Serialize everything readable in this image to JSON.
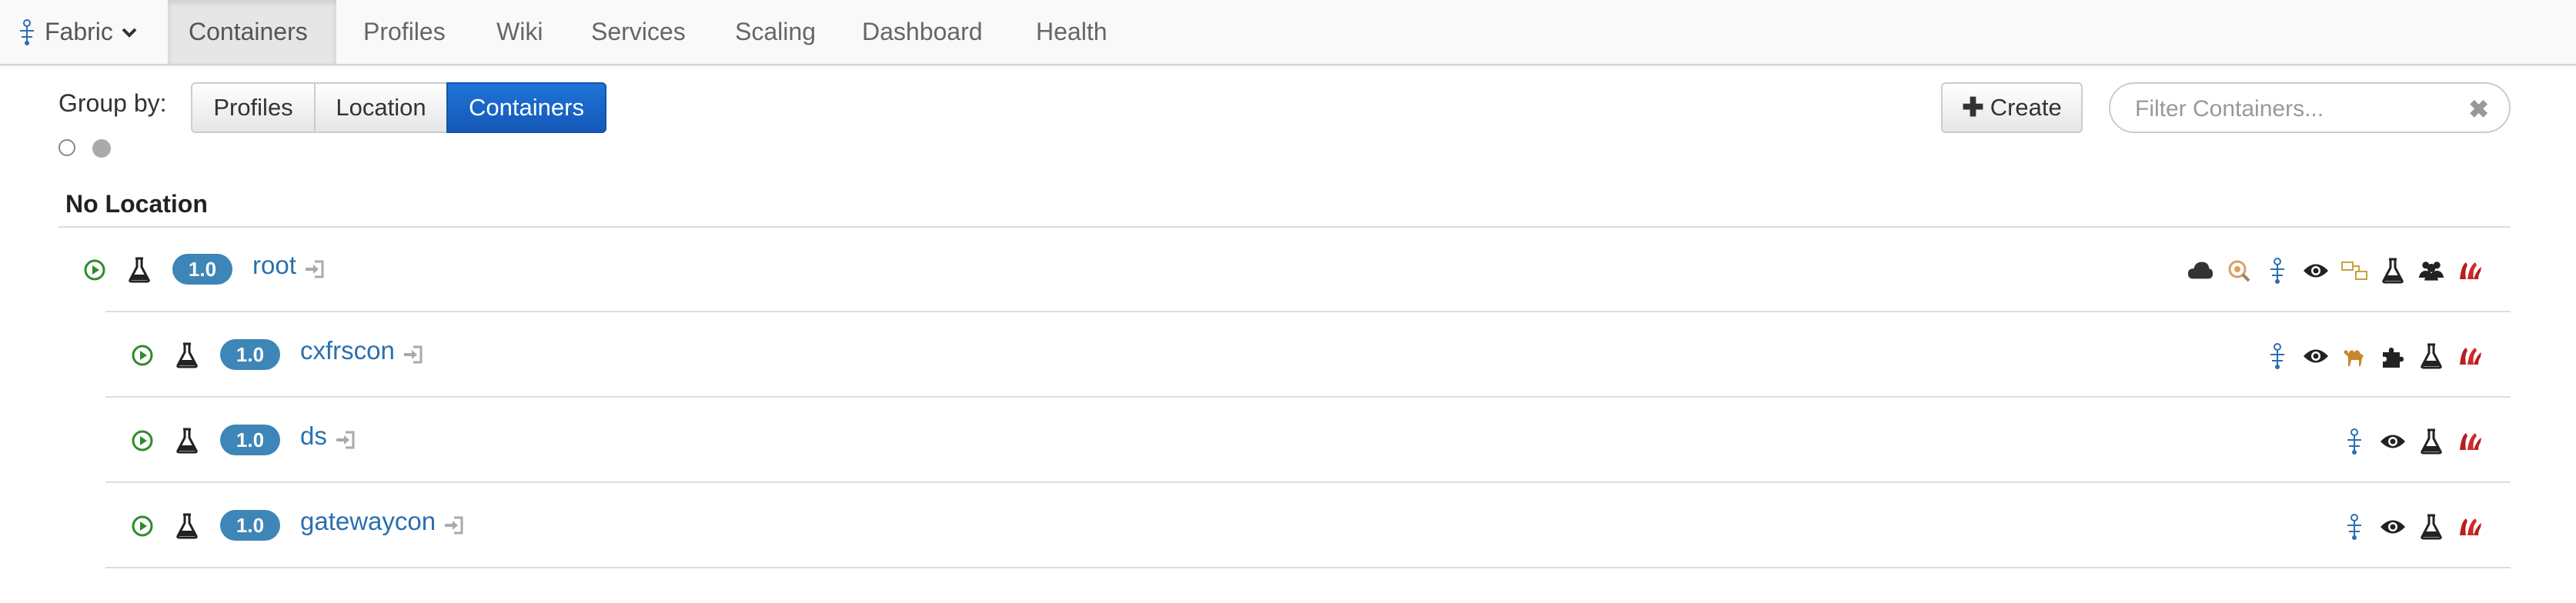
{
  "nav": {
    "brand": "Fabric",
    "tabs": [
      "Containers",
      "Profiles",
      "Wiki",
      "Services",
      "Scaling",
      "Dashboard",
      "Health"
    ],
    "active_tab": "Containers"
  },
  "toolbar": {
    "group_by_label": "Group by:",
    "group_options": [
      "Profiles",
      "Location",
      "Containers"
    ],
    "active_group": "Containers",
    "create_label": "Create",
    "filter_placeholder": "Filter Containers...",
    "filter_value": ""
  },
  "group": {
    "title": "No Location",
    "containers": [
      {
        "name": "root",
        "version": "1.0",
        "status": "running",
        "child": false,
        "icons": [
          "cloud-icon",
          "zoom-icon",
          "fabric-icon",
          "eye-icon",
          "message-icon",
          "flask-icon",
          "users-icon",
          "jolokia-icon"
        ]
      },
      {
        "name": "cxfrscon",
        "version": "1.0",
        "status": "running",
        "child": true,
        "icons": [
          "fabric-icon",
          "eye-icon",
          "camel-icon",
          "puzzle-icon",
          "flask-icon",
          "jolokia-icon"
        ]
      },
      {
        "name": "ds",
        "version": "1.0",
        "status": "running",
        "child": true,
        "icons": [
          "fabric-icon",
          "eye-icon",
          "flask-icon",
          "jolokia-icon"
        ]
      },
      {
        "name": "gatewaycon",
        "version": "1.0",
        "status": "running",
        "child": true,
        "icons": [
          "fabric-icon",
          "eye-icon",
          "flask-icon",
          "jolokia-icon"
        ]
      }
    ]
  },
  "colors": {
    "accent": "#1f74d6",
    "link": "#2a6fb0",
    "badge": "#3d86b7",
    "running": "#2e8b2e"
  }
}
